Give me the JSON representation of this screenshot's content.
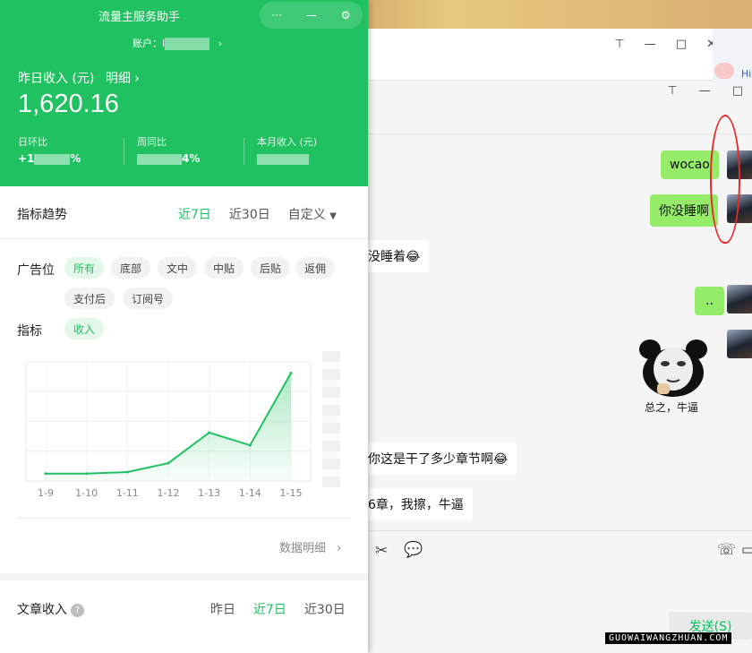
{
  "panel": {
    "title": "流量主服务助手",
    "window_controls": {
      "menu": "···",
      "minimize": "—",
      "settings": "⚙"
    },
    "account_label": "账户：",
    "account_value": "I",
    "account_chevron": "›",
    "income_label": "昨日收入 (元)",
    "detail_link": "明细 ›",
    "income_value": "1,620.16",
    "stats": [
      {
        "label": "日环比",
        "value_prefix": "+1",
        "value_suffix": "%"
      },
      {
        "label": "周同比",
        "value_prefix": "",
        "value_suffix": "4%"
      },
      {
        "label": "本月收入 (元)",
        "value_prefix": "",
        "value_suffix": ""
      }
    ]
  },
  "trend": {
    "title": "指标趋势",
    "tabs": [
      "近7日",
      "近30日",
      "自定义"
    ],
    "active_tab": "近7日",
    "dropdown_icon": "caret-down-icon"
  },
  "ad_filter": {
    "label": "广告位",
    "chips": [
      "所有",
      "底部",
      "文中",
      "中贴",
      "后贴",
      "返佣",
      "支付后",
      "订阅号"
    ],
    "active": "所有"
  },
  "metric_filter": {
    "label": "指标",
    "chips": [
      "收入"
    ],
    "active": "收入"
  },
  "chart_data": {
    "type": "area",
    "categories": [
      "1-9",
      "1-10",
      "1-11",
      "1-12",
      "1-13",
      "1-14",
      "1-15"
    ],
    "series": [
      {
        "values": [
          1,
          1,
          1.2,
          2.4,
          6.5,
          4.8,
          14.5
        ]
      }
    ],
    "ylim": [
      0,
      16
    ],
    "grid": true,
    "line_color": "#1fc160"
  },
  "data_detail_link": "数据明细",
  "article_income": {
    "title": "文章收入",
    "help_icon": "?",
    "tabs": [
      "昨日",
      "近7日",
      "近30日"
    ],
    "active_tab": "近7日"
  },
  "chat": {
    "window_controls": {
      "pin": "⊣",
      "minimize": "—",
      "maximize": "□",
      "close": "✕"
    },
    "messages": [
      {
        "side": "out",
        "text": "wocao"
      },
      {
        "side": "out",
        "text": "你没睡啊"
      },
      {
        "side": "in",
        "text": "没睡着😂"
      },
      {
        "side": "out",
        "text": ".."
      },
      {
        "side": "in",
        "text": "总之，牛逼"
      },
      {
        "side": "in",
        "text": "你这是干了多少章节啊😂"
      },
      {
        "side": "in",
        "text": "6章，我擦，牛逼"
      }
    ],
    "send_label": "发送(S)",
    "bg_window_hi": "Hi"
  },
  "watermark": "GUOWAIWANGZHUAN.COM"
}
